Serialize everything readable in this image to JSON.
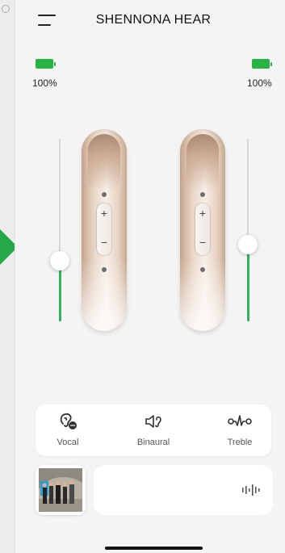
{
  "header": {
    "title": "SHENNONA HEAR"
  },
  "battery": {
    "left": {
      "level_text": "100%",
      "level": 100
    },
    "right": {
      "level_text": "100%",
      "level": 100
    },
    "color": "#28b442"
  },
  "sliders": {
    "left": {
      "value_percent": 33
    },
    "right": {
      "value_percent": 42
    },
    "fill_color": "#2fb65a"
  },
  "hearing_aids": {
    "left": {
      "plus_label": "+",
      "minus_label": "−"
    },
    "right": {
      "plus_label": "+",
      "minus_label": "−"
    }
  },
  "modes": [
    {
      "label": "Vocal",
      "icon": "ear-chat-icon"
    },
    {
      "label": "Binaural",
      "icon": "speaker-ear-icon"
    },
    {
      "label": "Treble",
      "icon": "treble-wave-icon"
    }
  ],
  "player": {
    "icon": "waveform-icon"
  }
}
